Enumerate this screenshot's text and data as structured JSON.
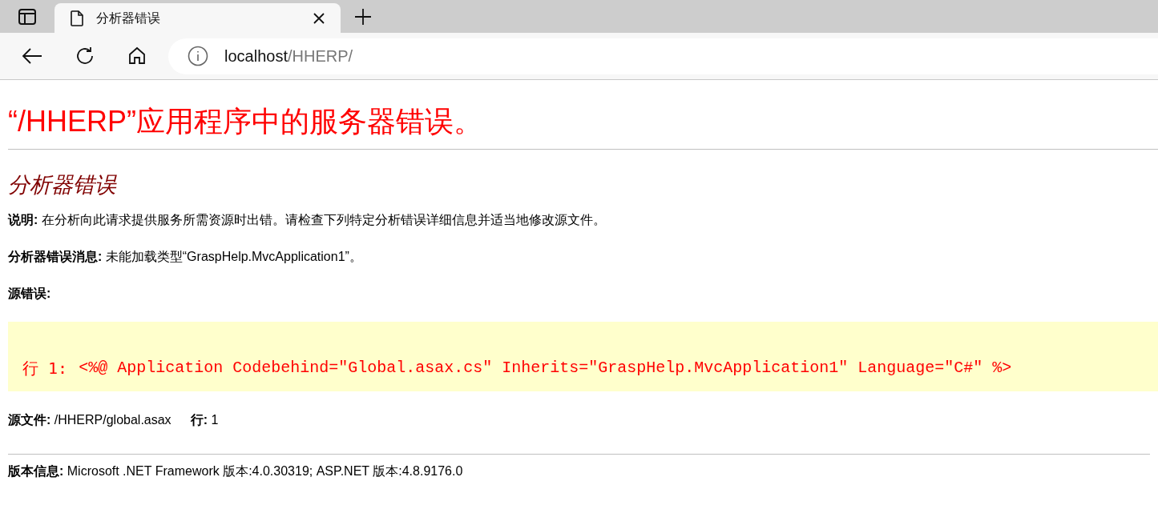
{
  "tabs": [
    {
      "title": "分析器错误",
      "selected": true
    }
  ],
  "address_bar": {
    "host": "localhost",
    "path": "/HHERP/"
  },
  "page": {
    "title": "“/HHERP”应用程序中的服务器错误。",
    "subtitle": "分析器错误",
    "description": "**说明:** 在分析向此请求提供服务所需资源时出错。请检查下列特定分析错误详细信息并适当地修改源文件。",
    "message": "**分析器错误消息:** 未能加载类型“GraspHelp.MvcApplication1”。",
    "source_error_label": "源错误:",
    "source_code": {
      "line_label": "行 1:",
      "code": "<%@ Application Codebehind=\"Global.asax.cs\" Inherits=\"GraspHelp.MvcApplication1\" Language=\"C#\" %>"
    },
    "source_file": "**源文件:** /HHERP/global.asax",
    "line": "**行:** 1",
    "version": "**版本信息:** Microsoft .NET Framework 版本:4.0.30319; ASP.NET 版本:4.8.9176.0"
  }
}
